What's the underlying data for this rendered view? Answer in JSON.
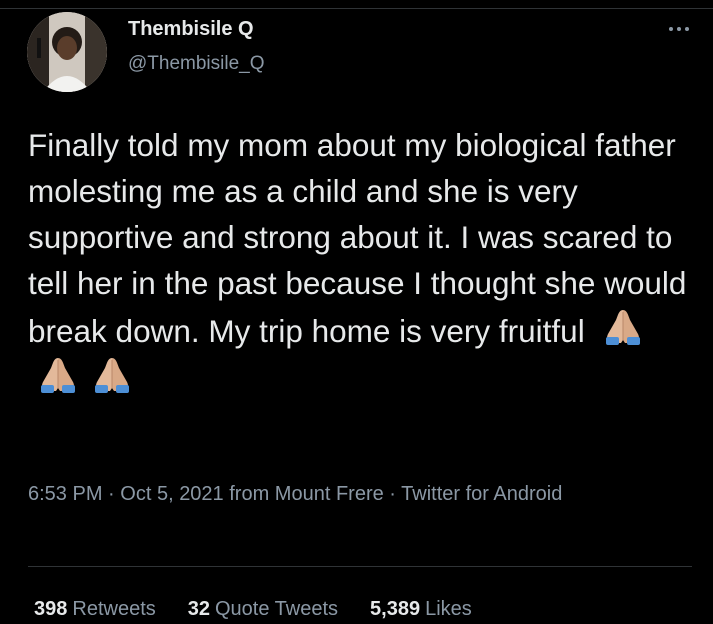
{
  "author": {
    "name": "Thembisile Q",
    "handle": "@Thembisile_Q"
  },
  "tweet": {
    "text": "Finally told my mom about my biological father molesting me as a child and she is very supportive and strong about it. I was scared to tell her in the past because I thought she would break down. My trip home is very fruitful",
    "emojis": [
      "folded-hands-icon",
      "folded-hands-icon",
      "folded-hands-icon"
    ]
  },
  "meta": {
    "time": "6:53 PM",
    "date": "Oct 5, 2021",
    "location": "from Mount Frere",
    "client": "Twitter for Android",
    "separator": "·"
  },
  "stats": {
    "retweets": {
      "count": "398",
      "label": "Retweets"
    },
    "quotes": {
      "count": "32",
      "label": "Quote Tweets"
    },
    "likes": {
      "count": "5,389",
      "label": "Likes"
    }
  },
  "colors": {
    "background": "#000000",
    "text_primary": "#e7e9ea",
    "text_secondary": "#8b98a5",
    "divider": "#2f3336"
  }
}
